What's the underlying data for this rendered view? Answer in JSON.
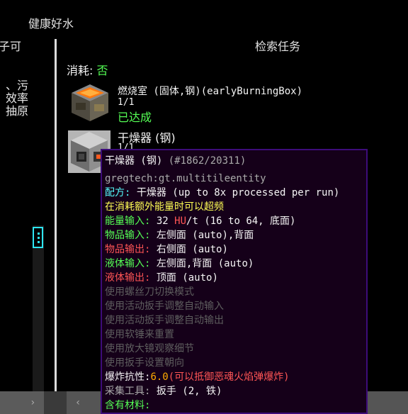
{
  "header": {
    "category_title": "健康好水",
    "left_fragment_1": "子可",
    "search_title": "检索任务"
  },
  "left_panel": {
    "frag_a": "、污",
    "frag_b": "效率",
    "frag_c": "抽原"
  },
  "consume": {
    "label": "消耗:",
    "value": "否"
  },
  "items": [
    {
      "name": "燃烧室 (固体,钢)(earlyBurningBox)",
      "count": "1/1",
      "status": "已达成",
      "icon": "burning-box-icon"
    },
    {
      "name": "干燥器 (钢)",
      "count": "1/1",
      "icon": "dryer-icon"
    }
  ],
  "tooltip": {
    "title": "干燥器 (钢)",
    "id": "(#1862/20311)",
    "registry": "gregtech:gt.multitileentity",
    "recipe_label": "配方:",
    "recipe_value": "干燥器 (up to 8x processed per run)",
    "overclock": "在消耗额外能量时可以超频",
    "energy_label": "能量输入:",
    "energy_amount": "32",
    "energy_unit_hu": "HU",
    "energy_unit_rest": "/t (16 to 64, 底面)",
    "item_in_label": "物品输入:",
    "item_in_value": "左侧面 (auto),背面",
    "item_out_label": "物品输出:",
    "item_out_value": "右侧面 (auto)",
    "fluid_in_label": "液体输入:",
    "fluid_in_value": "左侧面,背面 (auto)",
    "fluid_out_label": "液体输出:",
    "fluid_out_value": "顶面 (auto)",
    "hints": [
      "使用螺丝刀切换模式",
      "使用活动扳手调整自动输入",
      "使用活动扳手调整自动输出",
      "使用软锤来重置",
      "使用放大镜观察细节",
      "使用扳手设置朝向"
    ],
    "blast_label": "爆炸抗性:",
    "blast_value": "6.0",
    "blast_note": "(可以抵御恶魂火焰弹爆炸)",
    "harvest_label": "采集工具:",
    "harvest_value": "扳手 (2, 铁)",
    "material_label": "含有材料:"
  },
  "colors": {
    "tooltip_bg": "#150019",
    "tooltip_border": "#3d0c7a",
    "scroll_accent": "#2ee6f4",
    "achieved_green": "#55ff55"
  }
}
